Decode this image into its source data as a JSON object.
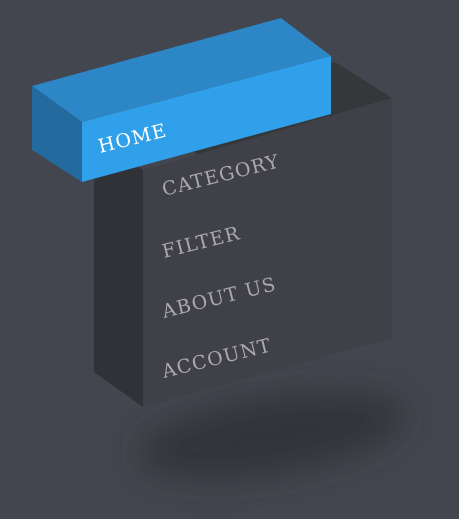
{
  "menu": {
    "items": [
      {
        "label": "HOME",
        "active": true
      },
      {
        "label": "CATEGORY",
        "active": false
      },
      {
        "label": "FILTER",
        "active": false
      },
      {
        "label": "ABOUT US",
        "active": false
      },
      {
        "label": "ACCOUNT",
        "active": false
      }
    ]
  },
  "colors": {
    "background": "#43464e",
    "panel_front": "#404148",
    "panel_side": "#2f3236",
    "panel_top": "#35383a",
    "active_front": "#30a0ea",
    "active_top": "#2d86c6",
    "active_side": "#236a9e",
    "active_text": "#ffffff",
    "item_text": "#a9a9ae"
  }
}
